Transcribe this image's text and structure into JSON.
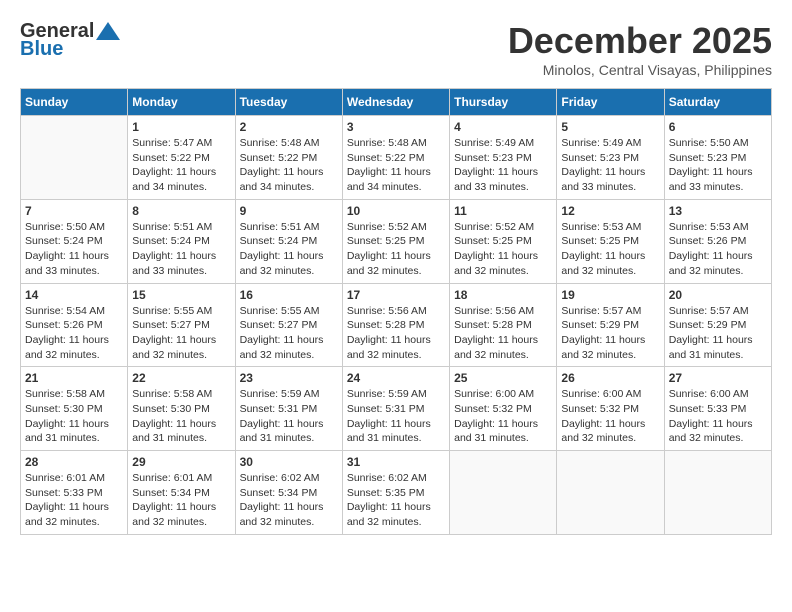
{
  "header": {
    "logo_general": "General",
    "logo_blue": "Blue",
    "month": "December 2025",
    "location": "Minolos, Central Visayas, Philippines"
  },
  "weekdays": [
    "Sunday",
    "Monday",
    "Tuesday",
    "Wednesday",
    "Thursday",
    "Friday",
    "Saturday"
  ],
  "weeks": [
    [
      {
        "day": "",
        "info": ""
      },
      {
        "day": "1",
        "info": "Sunrise: 5:47 AM\nSunset: 5:22 PM\nDaylight: 11 hours\nand 34 minutes."
      },
      {
        "day": "2",
        "info": "Sunrise: 5:48 AM\nSunset: 5:22 PM\nDaylight: 11 hours\nand 34 minutes."
      },
      {
        "day": "3",
        "info": "Sunrise: 5:48 AM\nSunset: 5:22 PM\nDaylight: 11 hours\nand 34 minutes."
      },
      {
        "day": "4",
        "info": "Sunrise: 5:49 AM\nSunset: 5:23 PM\nDaylight: 11 hours\nand 33 minutes."
      },
      {
        "day": "5",
        "info": "Sunrise: 5:49 AM\nSunset: 5:23 PM\nDaylight: 11 hours\nand 33 minutes."
      },
      {
        "day": "6",
        "info": "Sunrise: 5:50 AM\nSunset: 5:23 PM\nDaylight: 11 hours\nand 33 minutes."
      }
    ],
    [
      {
        "day": "7",
        "info": "Sunrise: 5:50 AM\nSunset: 5:24 PM\nDaylight: 11 hours\nand 33 minutes."
      },
      {
        "day": "8",
        "info": "Sunrise: 5:51 AM\nSunset: 5:24 PM\nDaylight: 11 hours\nand 33 minutes."
      },
      {
        "day": "9",
        "info": "Sunrise: 5:51 AM\nSunset: 5:24 PM\nDaylight: 11 hours\nand 32 minutes."
      },
      {
        "day": "10",
        "info": "Sunrise: 5:52 AM\nSunset: 5:25 PM\nDaylight: 11 hours\nand 32 minutes."
      },
      {
        "day": "11",
        "info": "Sunrise: 5:52 AM\nSunset: 5:25 PM\nDaylight: 11 hours\nand 32 minutes."
      },
      {
        "day": "12",
        "info": "Sunrise: 5:53 AM\nSunset: 5:25 PM\nDaylight: 11 hours\nand 32 minutes."
      },
      {
        "day": "13",
        "info": "Sunrise: 5:53 AM\nSunset: 5:26 PM\nDaylight: 11 hours\nand 32 minutes."
      }
    ],
    [
      {
        "day": "14",
        "info": "Sunrise: 5:54 AM\nSunset: 5:26 PM\nDaylight: 11 hours\nand 32 minutes."
      },
      {
        "day": "15",
        "info": "Sunrise: 5:55 AM\nSunset: 5:27 PM\nDaylight: 11 hours\nand 32 minutes."
      },
      {
        "day": "16",
        "info": "Sunrise: 5:55 AM\nSunset: 5:27 PM\nDaylight: 11 hours\nand 32 minutes."
      },
      {
        "day": "17",
        "info": "Sunrise: 5:56 AM\nSunset: 5:28 PM\nDaylight: 11 hours\nand 32 minutes."
      },
      {
        "day": "18",
        "info": "Sunrise: 5:56 AM\nSunset: 5:28 PM\nDaylight: 11 hours\nand 32 minutes."
      },
      {
        "day": "19",
        "info": "Sunrise: 5:57 AM\nSunset: 5:29 PM\nDaylight: 11 hours\nand 32 minutes."
      },
      {
        "day": "20",
        "info": "Sunrise: 5:57 AM\nSunset: 5:29 PM\nDaylight: 11 hours\nand 31 minutes."
      }
    ],
    [
      {
        "day": "21",
        "info": "Sunrise: 5:58 AM\nSunset: 5:30 PM\nDaylight: 11 hours\nand 31 minutes."
      },
      {
        "day": "22",
        "info": "Sunrise: 5:58 AM\nSunset: 5:30 PM\nDaylight: 11 hours\nand 31 minutes."
      },
      {
        "day": "23",
        "info": "Sunrise: 5:59 AM\nSunset: 5:31 PM\nDaylight: 11 hours\nand 31 minutes."
      },
      {
        "day": "24",
        "info": "Sunrise: 5:59 AM\nSunset: 5:31 PM\nDaylight: 11 hours\nand 31 minutes."
      },
      {
        "day": "25",
        "info": "Sunrise: 6:00 AM\nSunset: 5:32 PM\nDaylight: 11 hours\nand 31 minutes."
      },
      {
        "day": "26",
        "info": "Sunrise: 6:00 AM\nSunset: 5:32 PM\nDaylight: 11 hours\nand 32 minutes."
      },
      {
        "day": "27",
        "info": "Sunrise: 6:00 AM\nSunset: 5:33 PM\nDaylight: 11 hours\nand 32 minutes."
      }
    ],
    [
      {
        "day": "28",
        "info": "Sunrise: 6:01 AM\nSunset: 5:33 PM\nDaylight: 11 hours\nand 32 minutes."
      },
      {
        "day": "29",
        "info": "Sunrise: 6:01 AM\nSunset: 5:34 PM\nDaylight: 11 hours\nand 32 minutes."
      },
      {
        "day": "30",
        "info": "Sunrise: 6:02 AM\nSunset: 5:34 PM\nDaylight: 11 hours\nand 32 minutes."
      },
      {
        "day": "31",
        "info": "Sunrise: 6:02 AM\nSunset: 5:35 PM\nDaylight: 11 hours\nand 32 minutes."
      },
      {
        "day": "",
        "info": ""
      },
      {
        "day": "",
        "info": ""
      },
      {
        "day": "",
        "info": ""
      }
    ]
  ]
}
